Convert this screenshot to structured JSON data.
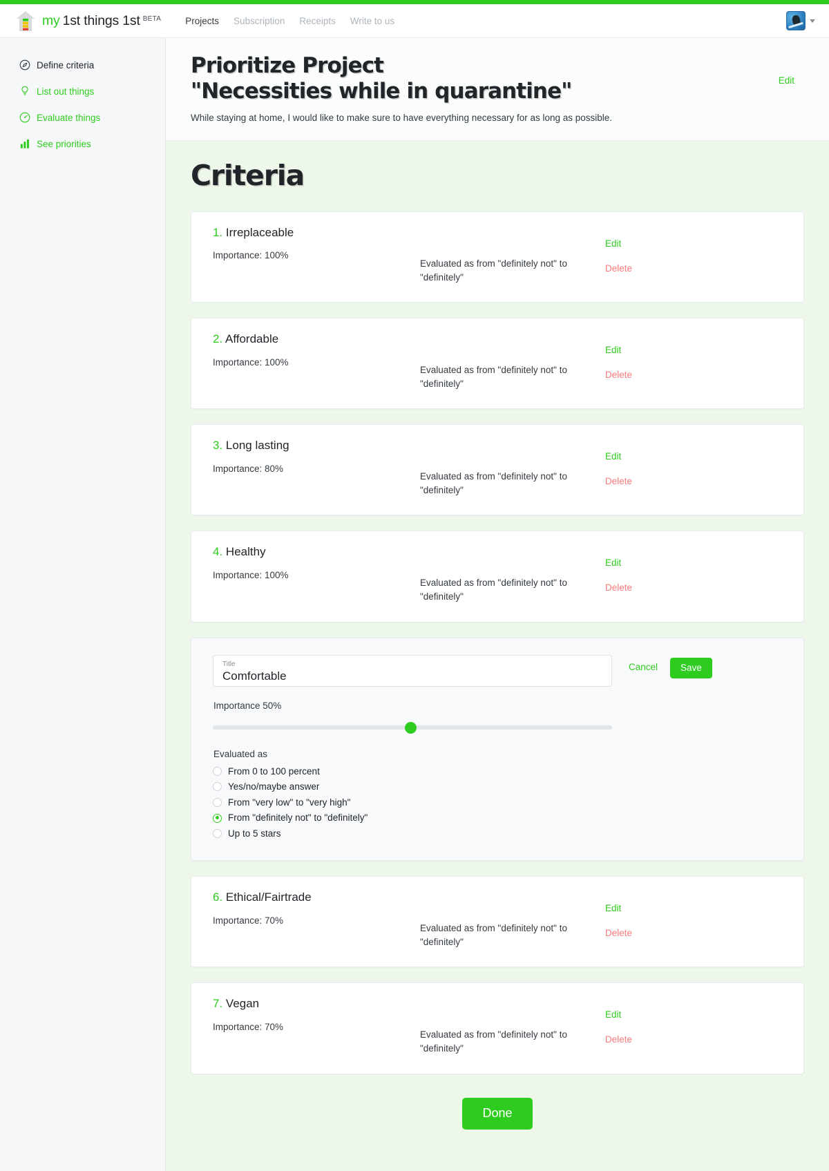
{
  "brand": {
    "prefix": "my",
    "name": "1st things 1st",
    "beta": "BETA",
    "logo_icon": "house-bars-logo"
  },
  "nav": {
    "links": [
      {
        "label": "Projects",
        "active": true
      },
      {
        "label": "Subscription",
        "active": false
      },
      {
        "label": "Receipts",
        "active": false
      },
      {
        "label": "Write to us",
        "active": false
      }
    ],
    "avatar_icon": "user-avatar",
    "caret_icon": "chevron-down-icon"
  },
  "sidebar": {
    "items": [
      {
        "label": "Define criteria",
        "icon": "compass-icon",
        "current": true
      },
      {
        "label": "List out things",
        "icon": "lightbulb-icon",
        "current": false
      },
      {
        "label": "Evaluate things",
        "icon": "gauge-icon",
        "current": false
      },
      {
        "label": "See priorities",
        "icon": "bar-chart-icon",
        "current": false
      }
    ]
  },
  "project": {
    "title_line1": "Prioritize Project",
    "title_line2": "\"Necessities while in quarantine\"",
    "description": "While staying at home, I would like to make sure to have everything necessary for as long as possible.",
    "edit_label": "Edit"
  },
  "section": {
    "title": "Criteria"
  },
  "criteria": [
    {
      "number": "1.",
      "title": "Irreplaceable",
      "importance": "Importance: 100%",
      "evaluated_as": "Evaluated as from \"definitely not\" to \"definitely\"",
      "edit_label": "Edit",
      "delete_label": "Delete"
    },
    {
      "number": "2.",
      "title": "Affordable",
      "importance": "Importance: 100%",
      "evaluated_as": "Evaluated as from \"definitely not\" to \"definitely\"",
      "edit_label": "Edit",
      "delete_label": "Delete"
    },
    {
      "number": "3.",
      "title": "Long lasting",
      "importance": "Importance: 80%",
      "evaluated_as": "Evaluated as from \"definitely not\" to \"definitely\"",
      "edit_label": "Edit",
      "delete_label": "Delete"
    },
    {
      "number": "4.",
      "title": "Healthy",
      "importance": "Importance: 100%",
      "evaluated_as": "Evaluated as from \"definitely not\" to \"definitely\"",
      "edit_label": "Edit",
      "delete_label": "Delete"
    }
  ],
  "edit_form": {
    "title_field_label": "Title",
    "title_value": "Comfortable",
    "importance_label": "Importance 50%",
    "importance_percent": 50,
    "evaluated_as_label": "Evaluated as",
    "options": [
      {
        "label": "From 0 to 100 percent",
        "selected": false
      },
      {
        "label": "Yes/no/maybe answer",
        "selected": false
      },
      {
        "label": "From \"very low\" to \"very high\"",
        "selected": false
      },
      {
        "label": "From \"definitely not\" to \"definitely\"",
        "selected": true
      },
      {
        "label": "Up to 5 stars",
        "selected": false
      }
    ],
    "cancel_label": "Cancel",
    "save_label": "Save"
  },
  "criteria_after": [
    {
      "number": "6.",
      "title": "Ethical/Fairtrade",
      "importance": "Importance: 70%",
      "evaluated_as": "Evaluated as from \"definitely not\" to \"definitely\"",
      "edit_label": "Edit",
      "delete_label": "Delete"
    },
    {
      "number": "7.",
      "title": "Vegan",
      "importance": "Importance: 70%",
      "evaluated_as": "Evaluated as from \"definitely not\" to \"definitely\"",
      "edit_label": "Edit",
      "delete_label": "Delete"
    }
  ],
  "footer": {
    "done_label": "Done"
  },
  "colors": {
    "accent_green": "#2ecc1e",
    "delete_red": "#fa7a7a",
    "content_bg": "#eef8ea",
    "text_dark": "#212529"
  }
}
